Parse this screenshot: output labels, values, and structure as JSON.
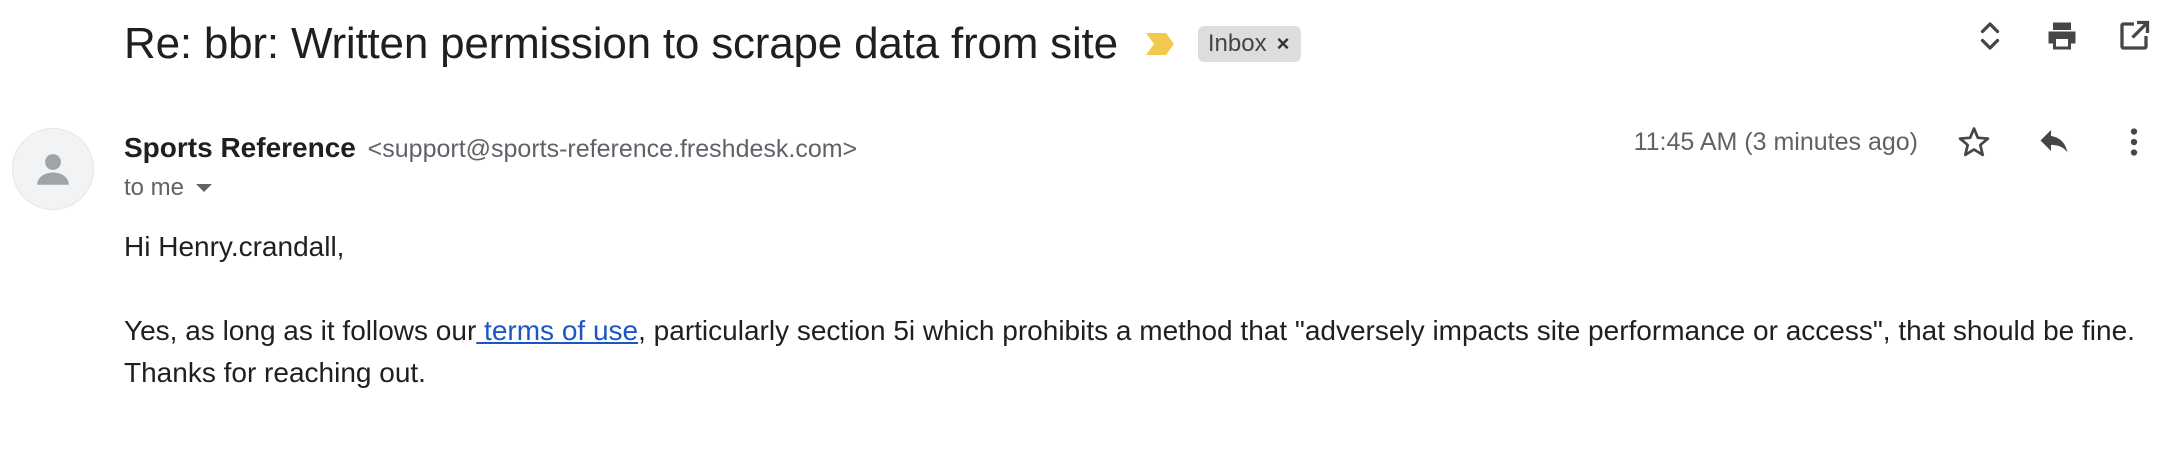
{
  "email": {
    "subject": "Re: bbr: Written permission to scrape data from site",
    "label_chip": "Inbox",
    "label_chip_remove": "×",
    "sender": {
      "name": "Sports Reference",
      "email": "<support@sports-reference.freshdesk.com>"
    },
    "recipient_line": "to me",
    "timestamp": "11:45 AM (3 minutes ago)",
    "body": {
      "greeting": "Hi Henry.crandall,",
      "para_before_link": "Yes, as long as it follows our",
      "link_text": " terms of use",
      "para_after_link": ", particularly section 5i which prohibits a method that \"adversely impacts site performance or access\", that should be fine. Thanks for reaching out."
    }
  },
  "icons": {
    "importance": "importance-marker-icon",
    "expand": "expand-collapse-icon",
    "print": "print-icon",
    "open_new_window": "open-in-new-window-icon",
    "star": "star-icon",
    "reply": "reply-icon",
    "more": "more-vertical-icon",
    "avatar": "person-icon"
  },
  "colors": {
    "importance": "#f2c94c",
    "link": "#1a56c5",
    "chip_bg": "#dddddd",
    "secondary_text": "#5f6368"
  }
}
